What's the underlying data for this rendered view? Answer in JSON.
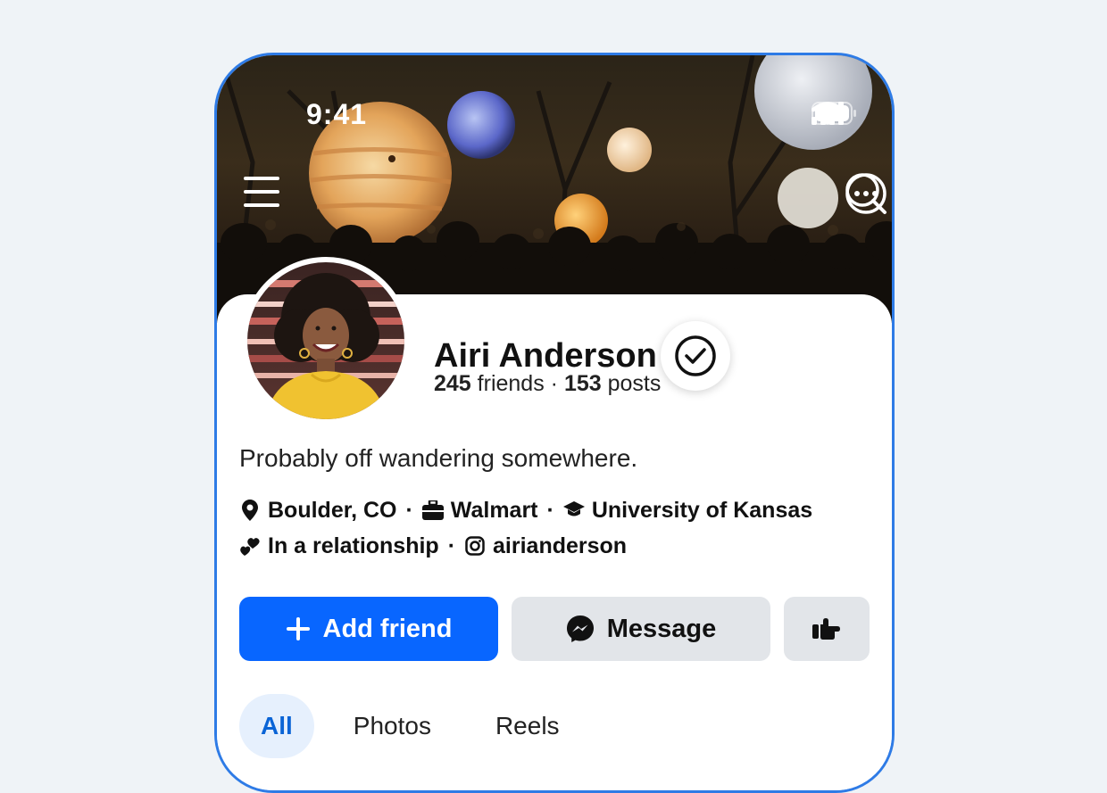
{
  "status": {
    "time": "9:41"
  },
  "icons": {
    "menu": "menu-icon",
    "more": "more-icon",
    "search": "search-icon",
    "signal": "signal-icon",
    "wifi": "wifi-icon",
    "battery": "battery-icon",
    "verified": "verified-icon"
  },
  "profile": {
    "name": "Airi Anderson",
    "friends_count": "245",
    "friends_label": "friends",
    "separator": "·",
    "posts_count": "153",
    "posts_label": "posts",
    "bio": "Probably off wandering somewhere.",
    "location": "Boulder, CO",
    "work": "Walmart",
    "education": "University of Kansas",
    "relationship": "In a relationship",
    "instagram": "airianderson"
  },
  "actions": {
    "add_friend": "Add friend",
    "message": "Message"
  },
  "tabs": [
    {
      "label": "All"
    },
    {
      "label": "Photos"
    },
    {
      "label": "Reels"
    }
  ],
  "colors": {
    "accent": "#0866ff",
    "frame": "#2e7be6",
    "secondary_button": "#e2e5e9",
    "active_tab_bg": "#e6f0fd",
    "active_tab_text": "#0a64d6"
  }
}
